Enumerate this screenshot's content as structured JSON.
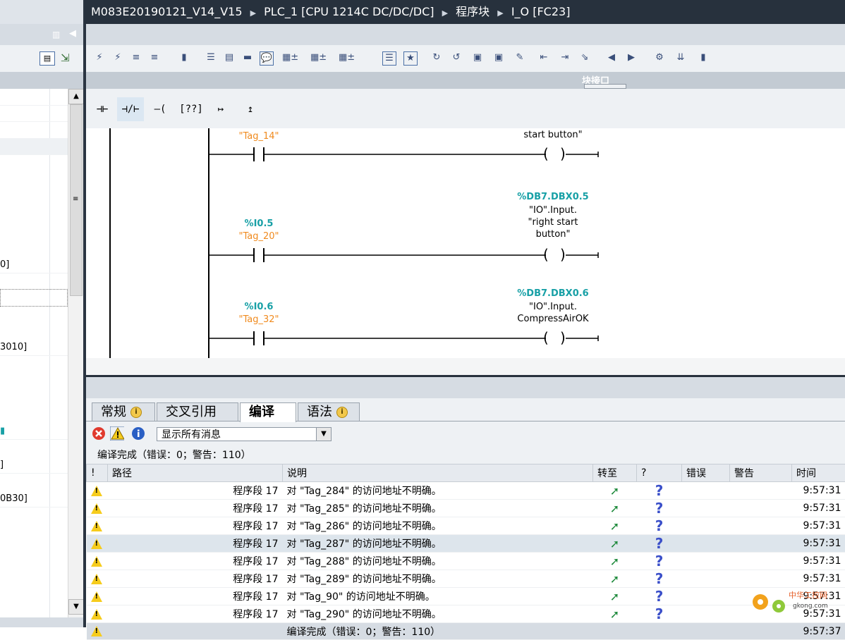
{
  "title_bar": {
    "project": "M083E20190121_V14_V15",
    "device": "PLC_1 [CPU 1214C DC/DC/DC]",
    "folder": "程序块",
    "block": "I_O [FC23]"
  },
  "block_interface_label": "块接口",
  "left_tree": {
    "fragments": [
      "0]",
      "3010]",
      "]",
      "0B30]"
    ]
  },
  "ladder": {
    "rungs": [
      {
        "contact_address": "",
        "contact_tag": "\"Tag_14\"",
        "coil_address": "",
        "coil_tag_lines": [
          "start button\""
        ]
      },
      {
        "contact_address": "%I0.5",
        "contact_tag": "\"Tag_20\"",
        "coil_address": "%DB7.DBX0.5",
        "coil_tag_lines": [
          "\"IO\".Input.",
          "\"right start",
          "button\""
        ]
      },
      {
        "contact_address": "%I0.6",
        "contact_tag": "\"Tag_32\"",
        "coil_address": "%DB7.DBX0.6",
        "coil_tag_lines": [
          "\"IO\".Input.",
          "CompressAirOK"
        ]
      }
    ]
  },
  "tabs": [
    "常规",
    "交叉引用",
    "编译",
    "语法"
  ],
  "active_tab": "编译",
  "filter": {
    "value": "显示所有消息"
  },
  "status_line": "编译完成（错误：0；警告：110）",
  "table": {
    "headers": [
      "!",
      "路径",
      "说明",
      "转至",
      "?",
      "错误",
      "警告",
      "时间"
    ],
    "rows": [
      {
        "path": "程序段 17",
        "desc": "对 \"Tag_284\" 的访问地址不明确。",
        "time": "9:57:31"
      },
      {
        "path": "程序段 17",
        "desc": "对 \"Tag_285\" 的访问地址不明确。",
        "time": "9:57:31"
      },
      {
        "path": "程序段 17",
        "desc": "对 \"Tag_286\" 的访问地址不明确。",
        "time": "9:57:31"
      },
      {
        "path": "程序段 17",
        "desc": "对 \"Tag_287\" 的访问地址不明确。",
        "time": "9:57:31"
      },
      {
        "path": "程序段 17",
        "desc": "对 \"Tag_288\" 的访问地址不明确。",
        "time": "9:57:31"
      },
      {
        "path": "程序段 17",
        "desc": "对 \"Tag_289\" 的访问地址不明确。",
        "time": "9:57:31"
      },
      {
        "path": "程序段 17",
        "desc": "对 \"Tag_90\" 的访问地址不明确。",
        "time": "9:57:31"
      },
      {
        "path": "程序段 17",
        "desc": "对 \"Tag_290\" 的访问地址不明确。",
        "time": "9:57:31"
      }
    ],
    "final_row": {
      "desc": "编译完成（错误：0；警告：110）",
      "time": "9:57:37"
    }
  },
  "watermark": {
    "main": "中华工控网",
    "url": "gkong.com"
  },
  "colors": {
    "title_bg": "#27313d",
    "teal": "#18a0a6",
    "orange": "#f08a1e",
    "warn": "#f6cc1c"
  }
}
